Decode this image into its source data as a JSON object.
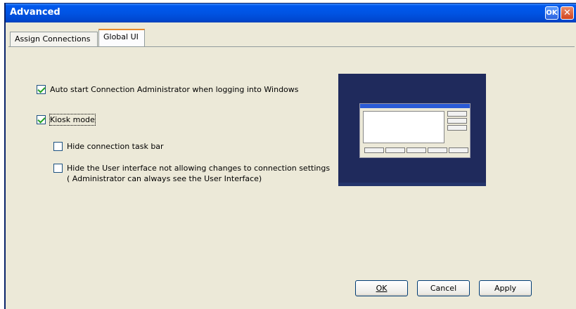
{
  "window": {
    "title": "Advanced",
    "ok_label": "OK",
    "close_label": "✕"
  },
  "tabs": [
    {
      "label": "Assign Connections"
    },
    {
      "label": "Global UI"
    }
  ],
  "options": [
    {
      "label": "Auto start Connection Administrator when logging into Windows",
      "checked": true
    },
    {
      "label": "Kiosk mode",
      "checked": true
    },
    {
      "label": "Hide connection task bar",
      "checked": false
    },
    {
      "label": "Hide the User interface not allowing changes to connection settings",
      "note": "( Administrator can always see the User Interface)",
      "checked": false
    }
  ],
  "buttons": {
    "ok": "OK",
    "cancel": "Cancel",
    "apply": "Apply"
  },
  "colors": {
    "titlebar": "#0054e3",
    "face": "#ece9d8",
    "preview_bg": "#1f2a5c",
    "check": "#21a121"
  }
}
